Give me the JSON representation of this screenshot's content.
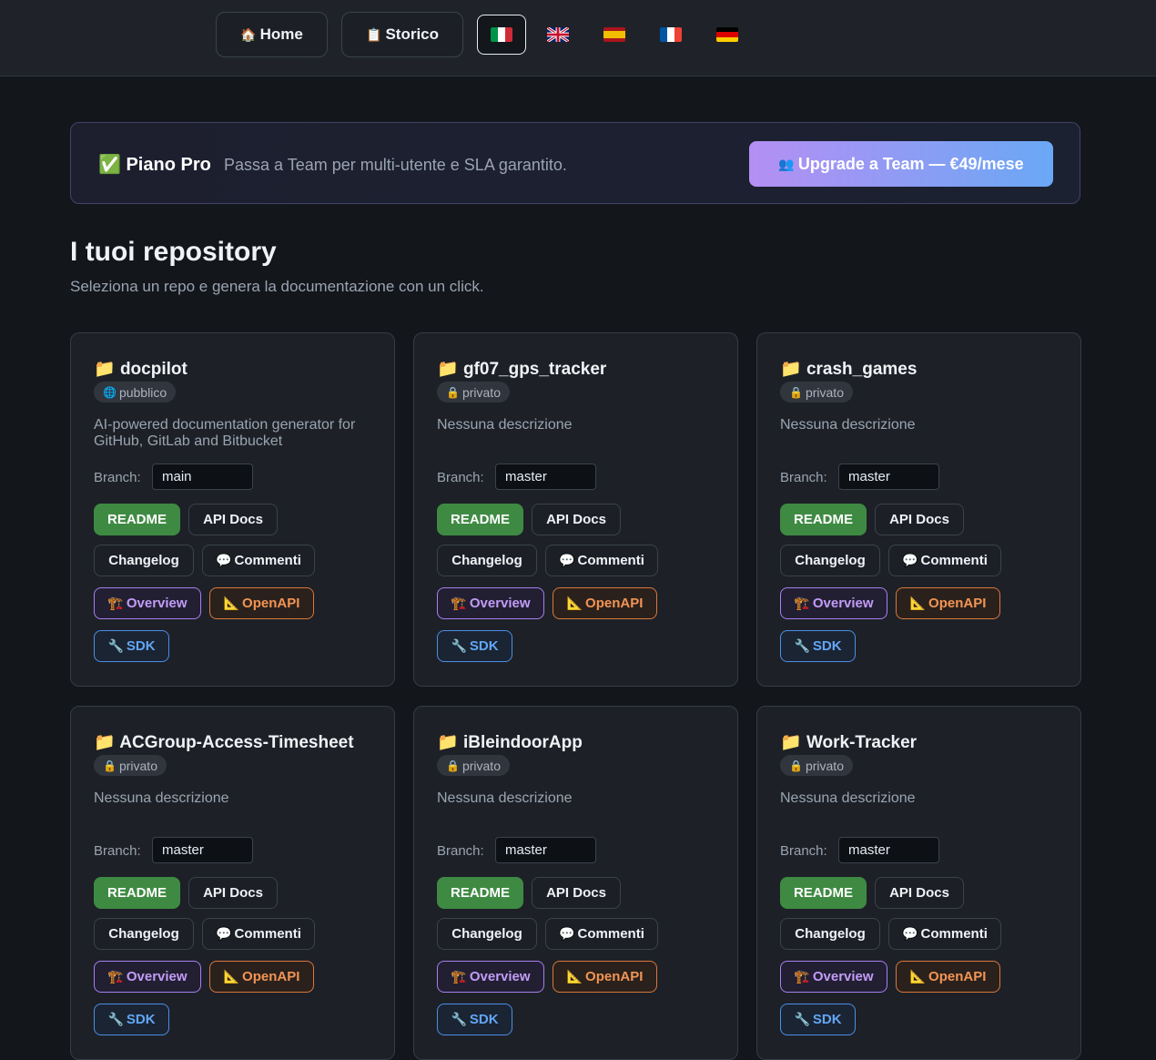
{
  "nav": {
    "home_icon": "🏠",
    "home_label": "Home",
    "history_icon": "📋",
    "history_label": "Storico",
    "languages": [
      {
        "code": "it",
        "colors": [
          "#009246",
          "#ffffff",
          "#ce2b37"
        ],
        "active": true
      },
      {
        "code": "en",
        "colors": [
          "#012169",
          "#ffffff",
          "#c8102e"
        ],
        "active": false
      },
      {
        "code": "es",
        "colors": [
          "#aa151b",
          "#f1bf00",
          "#aa151b"
        ],
        "active": false
      },
      {
        "code": "fr",
        "colors": [
          "#0055a4",
          "#ffffff",
          "#ef4135"
        ],
        "active": false
      },
      {
        "code": "de",
        "colors": [
          "#000000",
          "#dd0000",
          "#ffce00"
        ],
        "active": false
      }
    ]
  },
  "banner": {
    "plan_icon": "✅",
    "plan_label": "Piano Pro",
    "plan_desc": "Passa a Team per multi-utente e SLA garantito.",
    "upgrade_icon": "👥",
    "upgrade_label": "Upgrade a Team — €49/mese"
  },
  "main": {
    "title": "I tuoi repository",
    "subtitle": "Seleziona un repo e genera la documentazione con un click."
  },
  "labels": {
    "branch": "Branch:",
    "readme": "README",
    "api_docs": "API Docs",
    "changelog": "Changelog",
    "comments_icon": "💬",
    "comments": "Commenti",
    "overview_icon": "🏗️",
    "overview": "Overview",
    "openapi_icon": "📐",
    "openapi": "OpenAPI",
    "sdk_icon": "🔧",
    "sdk": "SDK",
    "folder_icon": "📁"
  },
  "repos": [
    {
      "name": "docpilot",
      "visibility_icon": "🌐",
      "visibility": "pubblico",
      "description": "AI-powered documentation generator for GitHub, GitLab and Bitbucket",
      "branch": "main"
    },
    {
      "name": "gf07_gps_tracker",
      "visibility_icon": "🔒",
      "visibility": "privato",
      "description": "Nessuna descrizione",
      "branch": "master"
    },
    {
      "name": "crash_games",
      "visibility_icon": "🔒",
      "visibility": "privato",
      "description": "Nessuna descrizione",
      "branch": "master"
    },
    {
      "name": "ACGroup-Access-Timesheet",
      "visibility_icon": "🔒",
      "visibility": "privato",
      "description": "Nessuna descrizione",
      "branch": "master"
    },
    {
      "name": "iBleindoorApp",
      "visibility_icon": "🔒",
      "visibility": "privato",
      "description": "Nessuna descrizione",
      "branch": "master"
    },
    {
      "name": "Work-Tracker",
      "visibility_icon": "🔒",
      "visibility": "privato",
      "description": "Nessuna descrizione",
      "branch": "master"
    }
  ]
}
